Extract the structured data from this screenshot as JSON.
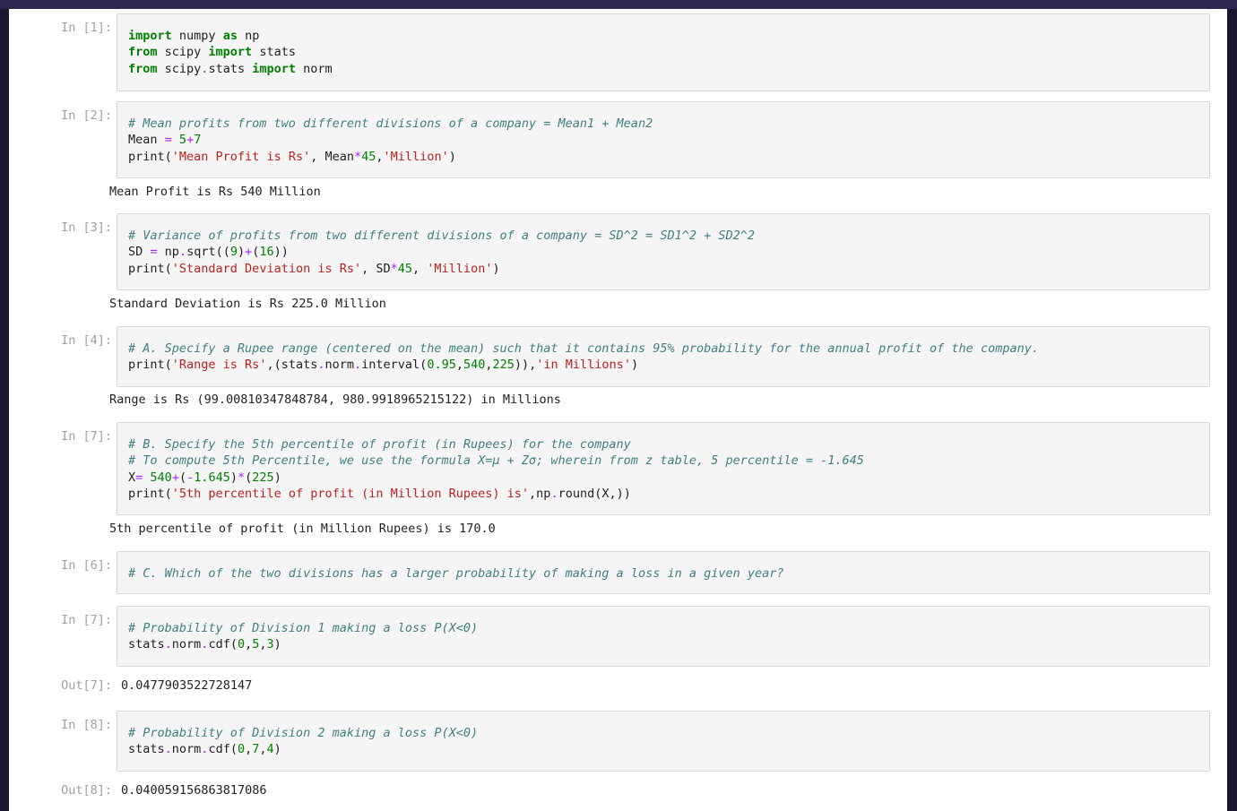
{
  "colors": {
    "keyword": "#008000",
    "comment": "#408080",
    "string": "#ba2121",
    "number": "#008000",
    "operator": "#aa22ff",
    "prompt": "#a0a0a0",
    "cell_bg": "#f5f5f5",
    "frame": "#1a1730"
  },
  "cells": [
    {
      "prompt": "In [1]:",
      "lines": [
        [
          {
            "t": "import",
            "c": "kw"
          },
          {
            "t": " numpy "
          },
          {
            "t": "as",
            "c": "kw"
          },
          {
            "t": " np"
          }
        ],
        [
          {
            "t": "from",
            "c": "kw"
          },
          {
            "t": " scipy "
          },
          {
            "t": "import",
            "c": "kw"
          },
          {
            "t": " stats"
          }
        ],
        [
          {
            "t": "from",
            "c": "kw"
          },
          {
            "t": " scipy"
          },
          {
            "t": ".",
            "c": "op"
          },
          {
            "t": "stats "
          },
          {
            "t": "import",
            "c": "kw"
          },
          {
            "t": " norm"
          }
        ]
      ]
    },
    {
      "prompt": "In [2]:",
      "lines": [
        [
          {
            "t": "# Mean profits from two different divisions of a company = Mean1 + Mean2",
            "c": "cm"
          }
        ],
        [
          {
            "t": "Mean "
          },
          {
            "t": "=",
            "c": "op"
          },
          {
            "t": " "
          },
          {
            "t": "5",
            "c": "nm"
          },
          {
            "t": "+",
            "c": "op"
          },
          {
            "t": "7",
            "c": "nm"
          }
        ],
        [
          {
            "t": "print("
          },
          {
            "t": "'Mean Profit is Rs'",
            "c": "st"
          },
          {
            "t": ", Mean"
          },
          {
            "t": "*",
            "c": "op"
          },
          {
            "t": "45",
            "c": "nm"
          },
          {
            "t": ","
          },
          {
            "t": "'Million'",
            "c": "st"
          },
          {
            "t": ")"
          }
        ]
      ],
      "output": "Mean Profit is Rs 540 Million"
    },
    {
      "prompt": "In [3]:",
      "lines": [
        [
          {
            "t": "# Variance of profits from two different divisions of a company = SD^2 = SD1^2 + SD2^2",
            "c": "cm"
          }
        ],
        [
          {
            "t": "SD "
          },
          {
            "t": "=",
            "c": "op"
          },
          {
            "t": " np"
          },
          {
            "t": ".",
            "c": "op"
          },
          {
            "t": "sqrt(("
          },
          {
            "t": "9",
            "c": "nm"
          },
          {
            "t": ")"
          },
          {
            "t": "+",
            "c": "op"
          },
          {
            "t": "("
          },
          {
            "t": "16",
            "c": "nm"
          },
          {
            "t": "))"
          }
        ],
        [
          {
            "t": "print("
          },
          {
            "t": "'Standard Deviation is Rs'",
            "c": "st"
          },
          {
            "t": ", SD"
          },
          {
            "t": "*",
            "c": "op"
          },
          {
            "t": "45",
            "c": "nm"
          },
          {
            "t": ", "
          },
          {
            "t": "'Million'",
            "c": "st"
          },
          {
            "t": ")"
          }
        ]
      ],
      "output": "Standard Deviation is Rs 225.0 Million"
    },
    {
      "prompt": "In [4]:",
      "lines": [
        [
          {
            "t": "# A. Specify a Rupee range (centered on the mean) such that it contains 95% probability for the annual profit of the company.",
            "c": "cm"
          }
        ],
        [
          {
            "t": "print("
          },
          {
            "t": "'Range is Rs'",
            "c": "st"
          },
          {
            "t": ",(stats"
          },
          {
            "t": ".",
            "c": "op"
          },
          {
            "t": "norm"
          },
          {
            "t": ".",
            "c": "op"
          },
          {
            "t": "interval("
          },
          {
            "t": "0.95",
            "c": "nm"
          },
          {
            "t": ","
          },
          {
            "t": "540",
            "c": "nm"
          },
          {
            "t": ","
          },
          {
            "t": "225",
            "c": "nm"
          },
          {
            "t": ")),"
          },
          {
            "t": "'in Millions'",
            "c": "st"
          },
          {
            "t": ")"
          }
        ]
      ],
      "output": "Range is Rs (99.00810347848784, 980.9918965215122) in Millions"
    },
    {
      "prompt": "In [7]:",
      "lines": [
        [
          {
            "t": "# B. Specify the 5th percentile of profit (in Rupees) for the company",
            "c": "cm"
          }
        ],
        [
          {
            "t": "# To compute 5th Percentile, we use the formula X=μ + Zσ; wherein from z table, 5 percentile = -1.645",
            "c": "cm"
          }
        ],
        [
          {
            "t": "X"
          },
          {
            "t": "=",
            "c": "op"
          },
          {
            "t": " "
          },
          {
            "t": "540",
            "c": "nm"
          },
          {
            "t": "+",
            "c": "op"
          },
          {
            "t": "("
          },
          {
            "t": "-",
            "c": "op"
          },
          {
            "t": "1.645",
            "c": "nm"
          },
          {
            "t": ")"
          },
          {
            "t": "*",
            "c": "op"
          },
          {
            "t": "("
          },
          {
            "t": "225",
            "c": "nm"
          },
          {
            "t": ")"
          }
        ],
        [
          {
            "t": "print("
          },
          {
            "t": "'5th percentile of profit (in Million Rupees) is'",
            "c": "st"
          },
          {
            "t": ",np"
          },
          {
            "t": ".",
            "c": "op"
          },
          {
            "t": "round(X,))"
          }
        ]
      ],
      "output": "5th percentile of profit (in Million Rupees) is 170.0"
    },
    {
      "prompt": "In [6]:",
      "lines": [
        [
          {
            "t": "# C. Which of the two divisions has a larger probability of making a loss in a given year?",
            "c": "cm"
          }
        ]
      ]
    },
    {
      "prompt": "In [7]:",
      "lines": [
        [
          {
            "t": "# Probability of Division 1 making a loss P(X<0)",
            "c": "cm"
          }
        ],
        [
          {
            "t": "stats"
          },
          {
            "t": ".",
            "c": "op"
          },
          {
            "t": "norm"
          },
          {
            "t": ".",
            "c": "op"
          },
          {
            "t": "cdf("
          },
          {
            "t": "0",
            "c": "nm"
          },
          {
            "t": ","
          },
          {
            "t": "5",
            "c": "nm"
          },
          {
            "t": ","
          },
          {
            "t": "3",
            "c": "nm"
          },
          {
            "t": ")"
          }
        ]
      ],
      "out_prompt": "Out[7]:",
      "out_value": "0.0477903522728147"
    },
    {
      "prompt": "In [8]:",
      "lines": [
        [
          {
            "t": "# Probability of Division 2 making a loss P(X<0)",
            "c": "cm"
          }
        ],
        [
          {
            "t": "stats"
          },
          {
            "t": ".",
            "c": "op"
          },
          {
            "t": "norm"
          },
          {
            "t": ".",
            "c": "op"
          },
          {
            "t": "cdf("
          },
          {
            "t": "0",
            "c": "nm"
          },
          {
            "t": ","
          },
          {
            "t": "7",
            "c": "nm"
          },
          {
            "t": ","
          },
          {
            "t": "4",
            "c": "nm"
          },
          {
            "t": ")"
          }
        ]
      ],
      "out_prompt": "Out[8]:",
      "out_value": "0.040059156863817086"
    }
  ]
}
